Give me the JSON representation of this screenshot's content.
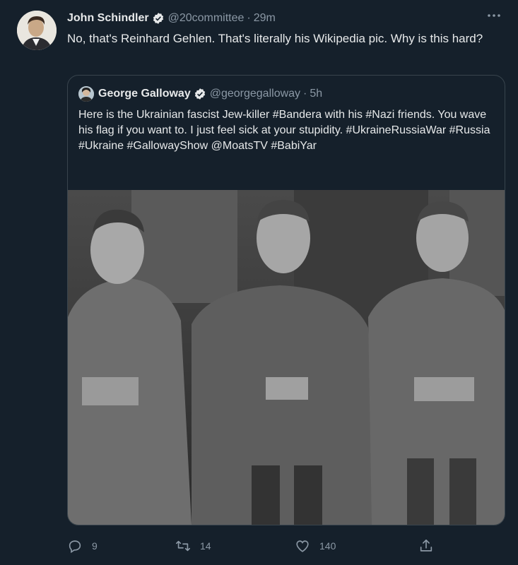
{
  "tweet": {
    "author_name": "John Schindler",
    "author_handle": "@20committee",
    "separator": "·",
    "time": "29m",
    "text": "No, that's Reinhard Gehlen. That's literally his Wikipedia pic. Why is this hard?",
    "more_icon": "ellipsis-icon"
  },
  "quoted": {
    "author_name": "George Galloway",
    "author_handle": "@georgegalloway",
    "separator": "·",
    "time": "5h",
    "text": "Here is  the Ukrainian fascist Jew-killer #Bandera with his #Nazi friends. You wave his flag if you want to. I just feel sick at your stupidity. #UkraineRussiaWar #Russia #Ukraine #GallowayShow @MoatsTV #BabiYar",
    "media": "black-and-white photo of three seated uniformed officers"
  },
  "actions": {
    "reply_count": "9",
    "retweet_count": "14",
    "like_count": "140",
    "icons": [
      "reply-icon",
      "retweet-icon",
      "like-icon",
      "share-icon"
    ]
  },
  "colors": {
    "background": "#15202b",
    "text": "#e7e9ea",
    "muted": "#8b98a5",
    "border": "#38444d",
    "verified": "#1d9bf0"
  }
}
